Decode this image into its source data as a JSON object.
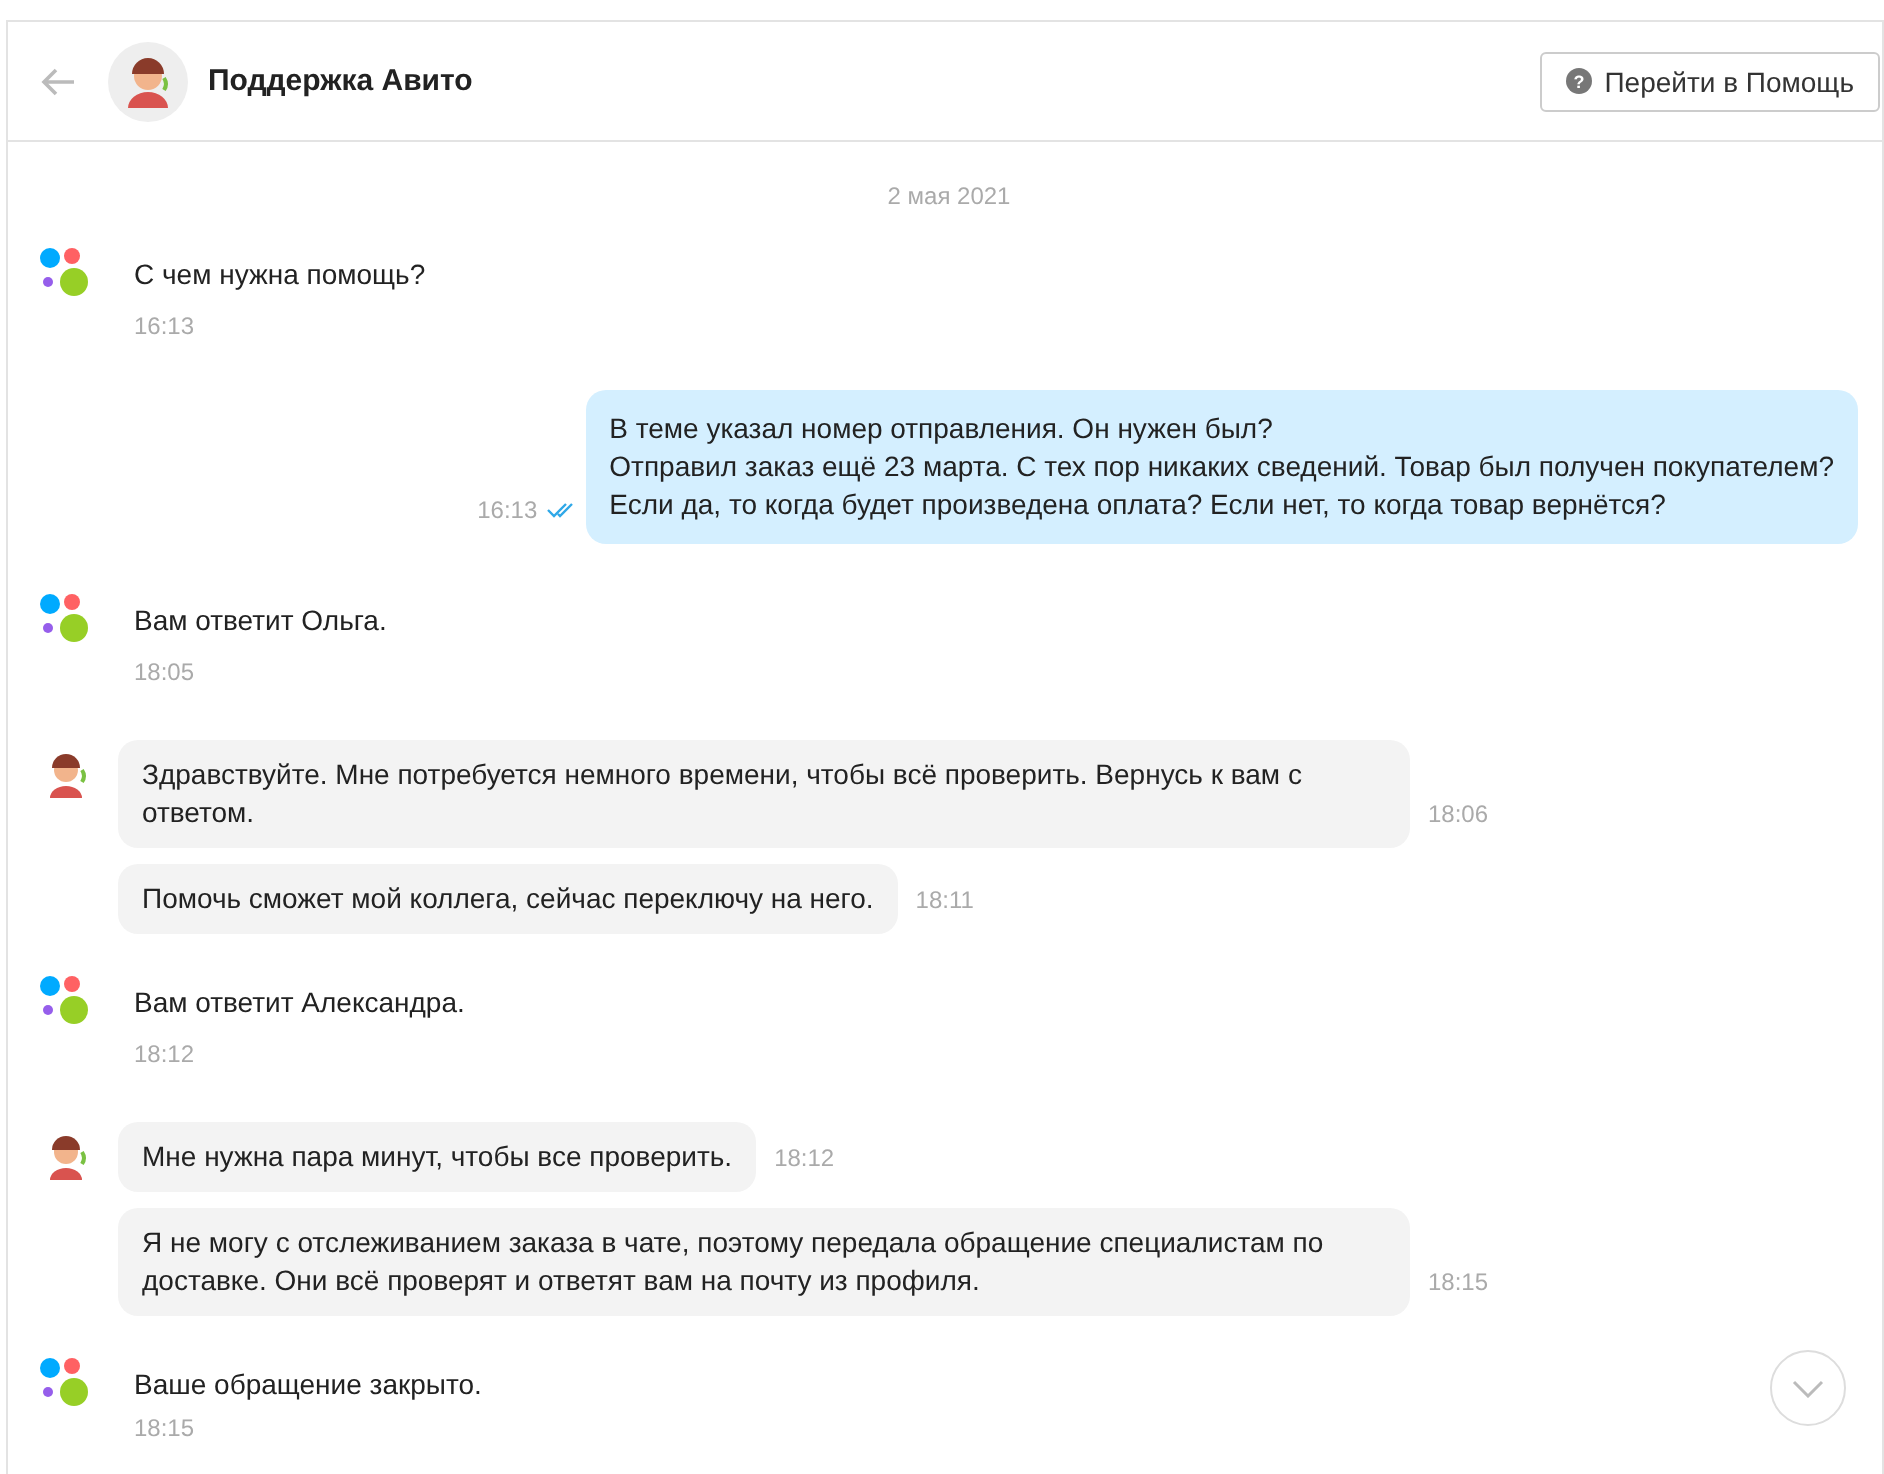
{
  "header": {
    "title": "Поддержка Авито",
    "help_icon": "?",
    "help_button": "Перейти в Помощь"
  },
  "date": "2 мая 2021",
  "messages": [
    {
      "kind": "system",
      "text": "С чем нужна помощь?",
      "time": "16:13"
    },
    {
      "kind": "user",
      "lines": [
        "В теме указал номер отправления. Он нужен был?",
        "Отправил заказ ещё 23 марта. С тех пор никаких сведений. Товар был получен покупателем?",
        "Если да, то когда будет произведена оплата? Если нет, то когда товар вернётся?"
      ],
      "time": "16:13",
      "read": true
    },
    {
      "kind": "system",
      "text": "Вам ответит Ольга.",
      "time": "18:05"
    },
    {
      "kind": "agent",
      "avatar": true,
      "text": "Здравствуйте. Мне потребуется немного времени, чтобы всё проверить. Вернусь к вам с ответом.",
      "time": "18:06"
    },
    {
      "kind": "agent",
      "avatar": false,
      "text": "Помочь сможет мой коллега, сейчас переключу на него.",
      "time": "18:11"
    },
    {
      "kind": "system",
      "text": "Вам ответит Александра.",
      "time": "18:12"
    },
    {
      "kind": "agent",
      "avatar": true,
      "text": "Мне нужна пара минут, чтобы все проверить.",
      "time": "18:12"
    },
    {
      "kind": "agent",
      "avatar": false,
      "text": "Я не могу с отслеживанием заказа в чате, поэтому передала обращение специалистам по доставке. Они всё проверят и ответят вам на почту из профиля.",
      "time": "18:15"
    },
    {
      "kind": "system",
      "text": "Ваше обращение закрыто.",
      "time": "18:15"
    }
  ]
}
